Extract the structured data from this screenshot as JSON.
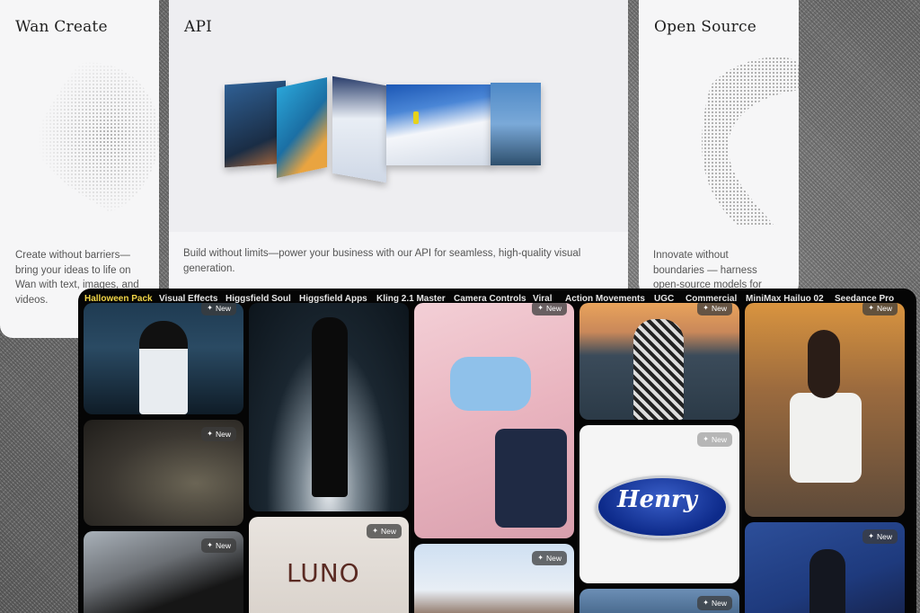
{
  "cards": {
    "wan": {
      "title": "Wan Create",
      "text": "Create without barriers—bring your ideas to life on Wan with text, images, and videos."
    },
    "api": {
      "title": "API",
      "text": "Build without limits—power your business with our API for seamless, high-quality visual generation."
    },
    "open_source": {
      "title": "Open Source",
      "text": "Innovate without boundaries — harness open-source models for"
    }
  },
  "gallery": {
    "tabs": [
      {
        "label": "Halloween Pack",
        "active": true
      },
      {
        "label": "Visual Effects",
        "active": false
      },
      {
        "label": "Higgsfield Soul",
        "active": false
      },
      {
        "label": "Higgsfield Apps",
        "active": false
      },
      {
        "label": "Kling 2.1 Master",
        "active": false
      },
      {
        "label": "Camera Controls",
        "active": false
      },
      {
        "label": "Viral",
        "active": false
      },
      {
        "label": "Action Movements",
        "active": false
      },
      {
        "label": "UGC",
        "active": false
      },
      {
        "label": "Commercial",
        "active": false
      },
      {
        "label": "MiniMax Hailuo 02",
        "active": false
      },
      {
        "label": "Seedance Pro",
        "active": false
      }
    ],
    "badge_label": "New",
    "tile_texts": {
      "luno": "LUNO",
      "henry": "Henry"
    }
  },
  "colors": {
    "active_tab": "#f2d648",
    "gallery_bg": "#050505",
    "card_bg": "#f4f4f6"
  }
}
